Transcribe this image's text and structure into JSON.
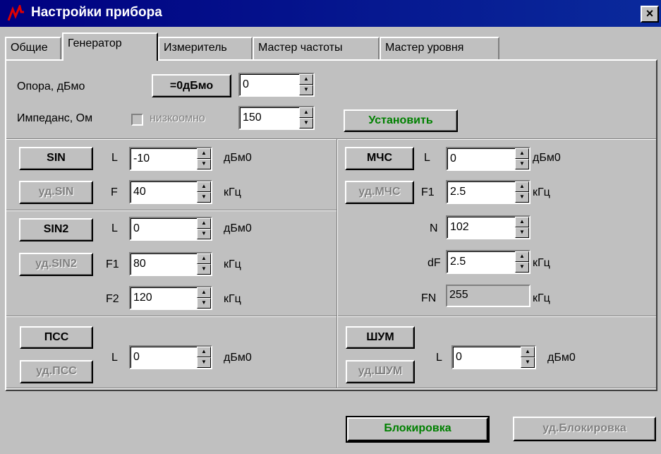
{
  "window": {
    "title": "Настройки прибора",
    "close_glyph": "×"
  },
  "tabs": [
    {
      "label": "Общие"
    },
    {
      "label": "Генератор"
    },
    {
      "label": "Измеритель"
    },
    {
      "label": "Мастер частоты"
    },
    {
      "label": "Мастер уровня"
    }
  ],
  "active_tab": "Генератор",
  "top": {
    "ref_label": "Опора, дБмо",
    "ref_button": "=0дБмо",
    "ref_value": "0",
    "imp_label": "Импеданс, Ом",
    "low_imp_label": "низкоомно",
    "imp_value": "150",
    "set_button": "Установить"
  },
  "sin": {
    "button": "SIN",
    "remove_button": "уд.SIN",
    "l_label": "L",
    "l_value": "-10",
    "l_unit": "дБм0",
    "f_label": "F",
    "f_value": "40",
    "f_unit": "кГц"
  },
  "sin2": {
    "button": "SIN2",
    "remove_button": "уд.SIN2",
    "l_label": "L",
    "l_value": "0",
    "l_unit": "дБм0",
    "f1_label": "F1",
    "f1_value": "80",
    "f1_unit": "кГц",
    "f2_label": "F2",
    "f2_value": "120",
    "f2_unit": "кГц"
  },
  "mcs": {
    "button": "МЧС",
    "remove_button": "уд.МЧС",
    "l_label": "L",
    "l_value": "0",
    "l_unit": "дБм0",
    "f1_label": "F1",
    "f1_value": "2.5",
    "f1_unit": "кГц",
    "n_label": "N",
    "n_value": "102",
    "df_label": "dF",
    "df_value": "2.5",
    "df_unit": "кГц",
    "fn_label": "FN",
    "fn_value": "255",
    "fn_unit": "кГц"
  },
  "pss": {
    "button": "ПСС",
    "remove_button": "уд.ПСС",
    "l_label": "L",
    "l_value": "0",
    "l_unit": "дБм0"
  },
  "noise": {
    "button": "ШУМ",
    "remove_button": "уд.ШУМ",
    "l_label": "L",
    "l_value": "0",
    "l_unit": "дБм0"
  },
  "bottom": {
    "lock_button": "Блокировка",
    "unlock_button": "уд.Блокировка"
  },
  "colors": {
    "title_bar": "#000080",
    "face": "#c0c0c0",
    "green_text": "#008000",
    "disabled_text": "#808080"
  },
  "icons": {
    "arrow_up": "▲",
    "arrow_down": "▼"
  }
}
